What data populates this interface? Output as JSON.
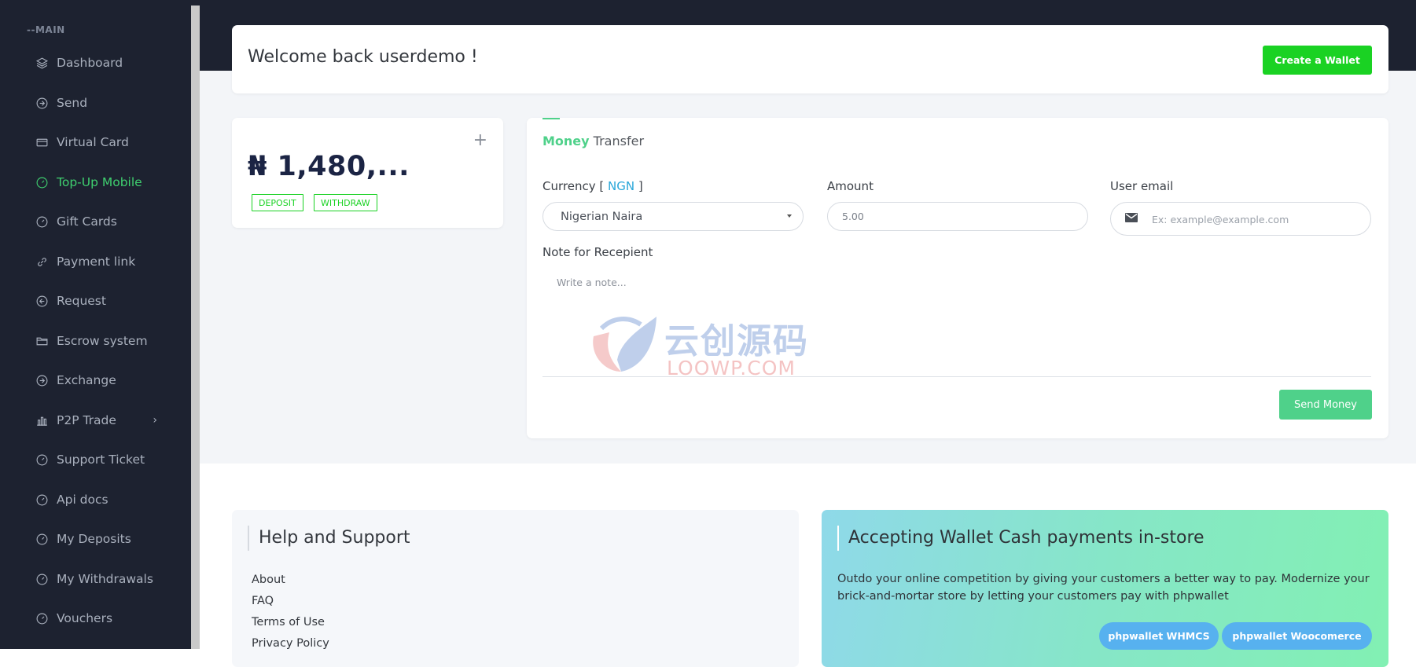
{
  "sidebar": {
    "section_label": "--MAIN",
    "items": [
      {
        "label": "Dashboard",
        "icon": "layers-icon"
      },
      {
        "label": "Send",
        "icon": "arrow-right-circle-icon"
      },
      {
        "label": "Virtual Card",
        "icon": "credit-card-icon"
      },
      {
        "label": "Top-Up Mobile",
        "icon": "gauge-icon",
        "active": true
      },
      {
        "label": "Gift Cards",
        "icon": "gauge-icon"
      },
      {
        "label": "Payment link",
        "icon": "link-icon"
      },
      {
        "label": "Request",
        "icon": "arrow-left-circle-icon"
      },
      {
        "label": "Escrow system",
        "icon": "folder-icon"
      },
      {
        "label": "Exchange",
        "icon": "arrow-right-circle-icon"
      },
      {
        "label": "P2P Trade",
        "icon": "bar-chart-icon",
        "has_submenu": true
      },
      {
        "label": "Support Ticket",
        "icon": "gauge-icon"
      },
      {
        "label": "Api docs",
        "icon": "gauge-icon"
      },
      {
        "label": "My Deposits",
        "icon": "gauge-icon"
      },
      {
        "label": "My Withdrawals",
        "icon": "gauge-icon"
      },
      {
        "label": "Vouchers",
        "icon": "gauge-icon"
      }
    ],
    "chevron": "›",
    "active_color": "#3fcf6f"
  },
  "welcome": {
    "title": "Welcome back userdemo !",
    "create_wallet_label": "Create a Wallet",
    "button_color": "#1ad223"
  },
  "balance": {
    "plus": "+",
    "amount": "₦ 1,480,...",
    "deposit_label": "DEPOSIT",
    "withdraw_label": "WITHDRAW"
  },
  "transfer": {
    "title_highlight": "Money",
    "title_rest": " Transfer",
    "currency_label": "Currency [ ",
    "currency_code": "NGN",
    "currency_close": " ]",
    "currency_value": "Nigerian Naira",
    "amount_label": "Amount",
    "amount_value": "5.00",
    "email_label": "User email",
    "email_placeholder": "Ex: example@example.com",
    "note_label": "Note for Recepient",
    "note_placeholder": "Write a note...",
    "send_label": "Send Money",
    "accent_color": "#4fd18a"
  },
  "watermark": {
    "cn": "云创源码",
    "en": "LOOWP.COM"
  },
  "help": {
    "title": "Help and Support",
    "links": [
      "About",
      "FAQ",
      "Terms of Use",
      "Privacy Policy"
    ]
  },
  "accept": {
    "title": "Accepting Wallet Cash payments in-store",
    "description": "Outdo your online competition by giving your customers a better way to pay. Modernize your brick-and-mortar store by letting your customers pay with phpwallet",
    "buttons": [
      "phpwallet WHMCS",
      "phpwallet Woocomerce"
    ]
  }
}
